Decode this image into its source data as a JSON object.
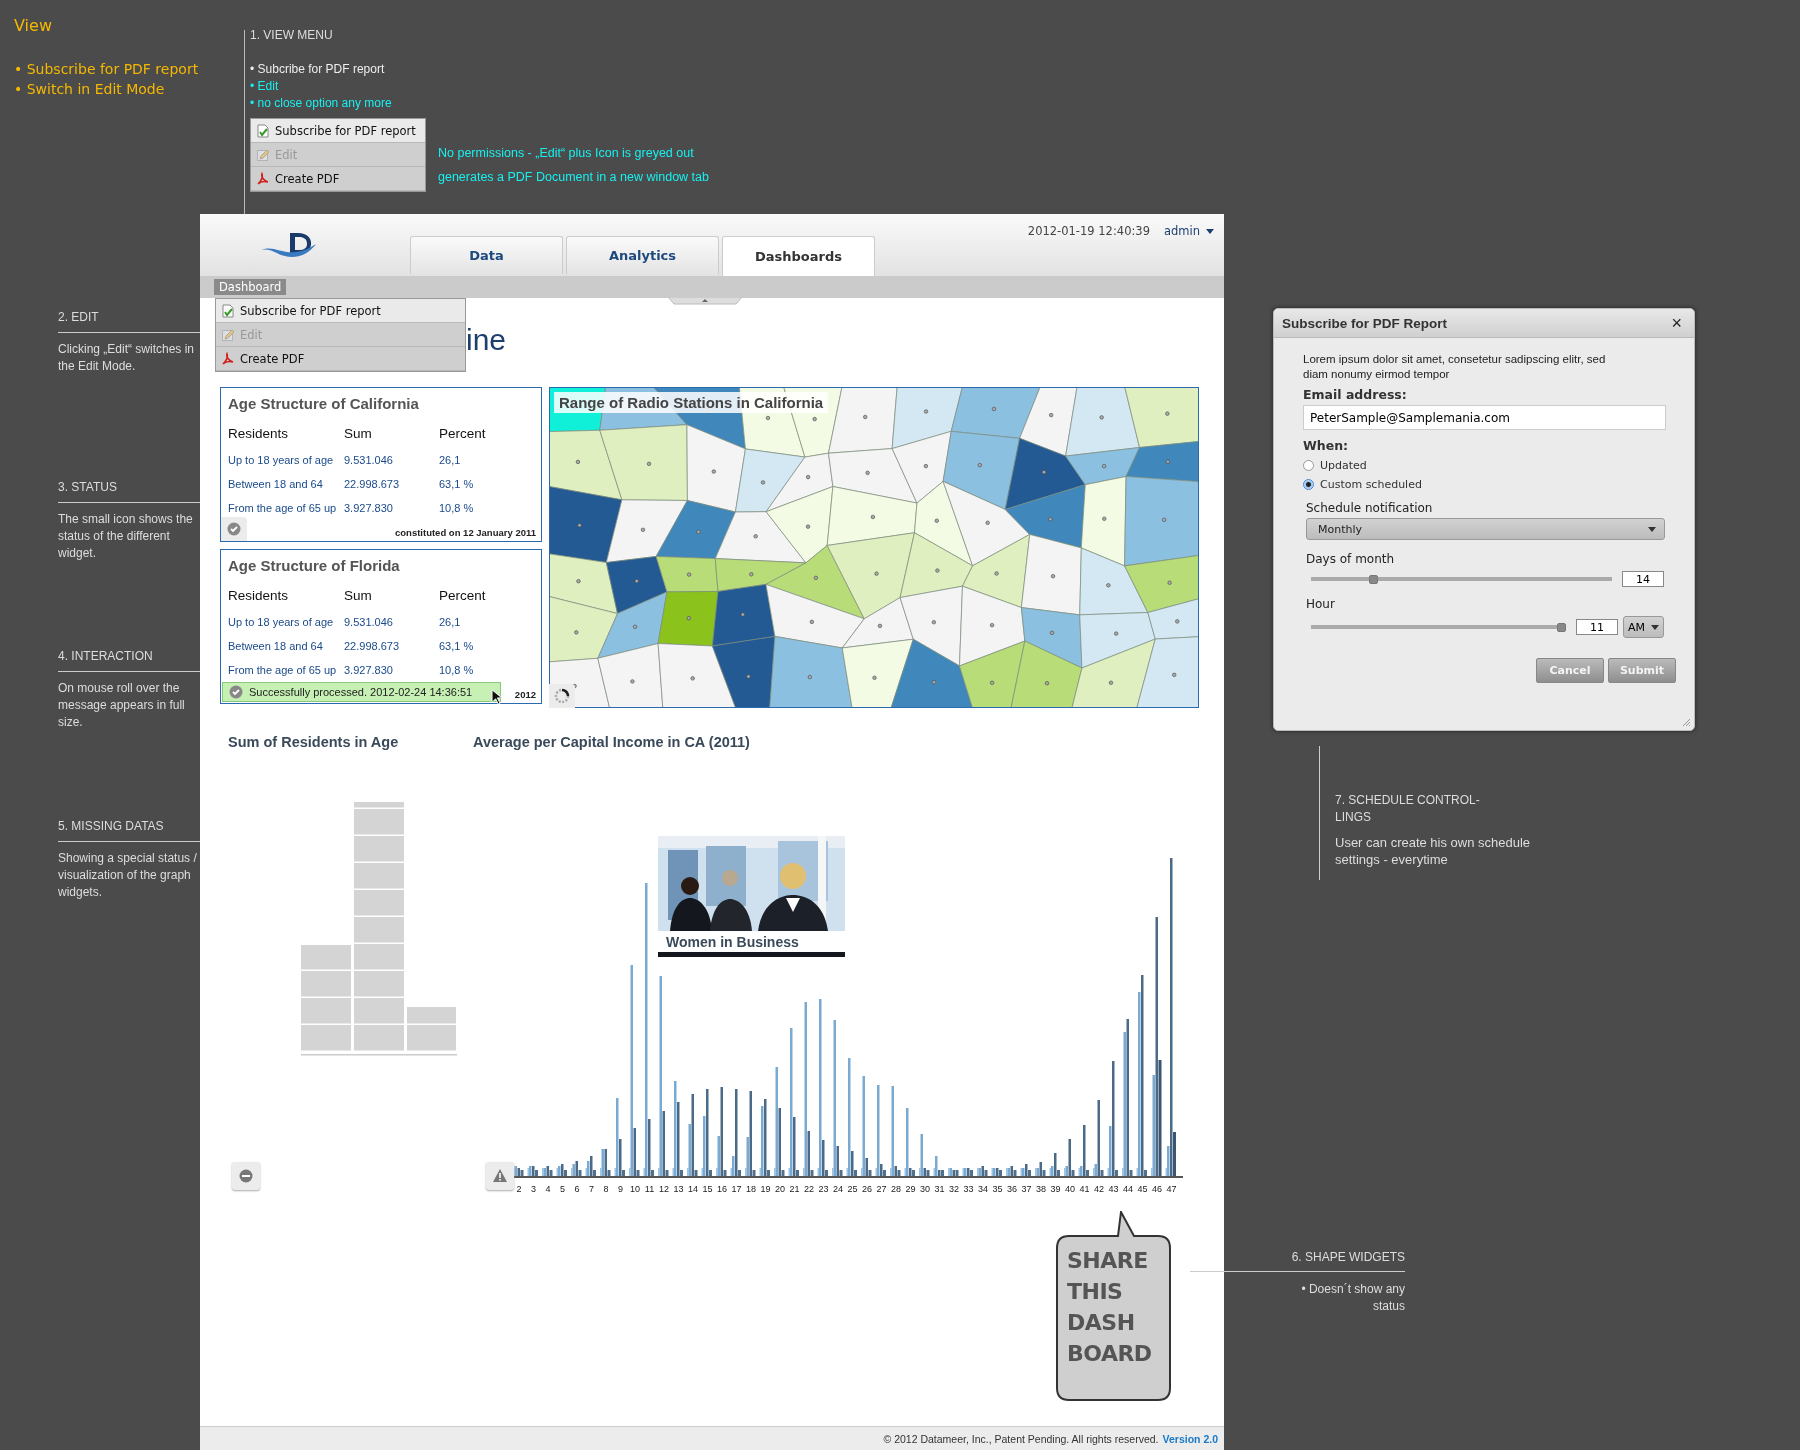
{
  "view_panel": {
    "title": "View",
    "items": [
      "• Subscribe for PDF report",
      "• Switch in Edit Mode"
    ]
  },
  "view_menu_note": {
    "heading": "1. VIEW MENU",
    "bullets": [
      {
        "text": "• Subcribe for PDF report",
        "highlight": false
      },
      {
        "text": "• Edit",
        "highlight": true
      },
      {
        "text": "• no close option any more",
        "highlight": true
      }
    ],
    "menu": [
      {
        "label": "Subscribe for PDF report",
        "kind": "subscribe",
        "disabled": false
      },
      {
        "label": "Edit",
        "kind": "edit",
        "disabled": true
      },
      {
        "label": "Create PDF",
        "kind": "pdf",
        "disabled": false
      }
    ],
    "notes": [
      "No permissions - „Edit“ plus Icon is greyed out",
      "generates a PDF Document in a new window tab"
    ]
  },
  "side_notes": [
    {
      "heading": "2. EDIT",
      "text": "Clicking „Edit“ switches in the Edit Mode."
    },
    {
      "heading": "3. STATUS",
      "text": "The small icon shows the status of the different widget."
    },
    {
      "heading": "4. INTERACTION",
      "text": "On mouse roll over the message appears in full size."
    },
    {
      "heading": "5. MISSING DATAS",
      "text": "Showing a special status / visualization of the graph widgets."
    }
  ],
  "schedule_note": {
    "heading": "7. SCHEDULE CONTROL-LINGS",
    "text": "User can create his own schedule settings - everytime"
  },
  "shape_note": {
    "heading": "6. SHAPE WIDGETS",
    "text": "• Doesn´t show any status"
  },
  "app": {
    "tabs": [
      {
        "label": "Data",
        "selected": false
      },
      {
        "label": "Analytics",
        "selected": false
      },
      {
        "label": "Dashboards",
        "selected": true
      }
    ],
    "datetime": "2012-01-19 12:40:39",
    "user": "admin",
    "breadcrumb": "Dashboard",
    "menu": [
      {
        "label": "Subscribe for PDF report",
        "kind": "subscribe",
        "disabled": false
      },
      {
        "label": "Edit",
        "kind": "edit",
        "disabled": true
      },
      {
        "label": "Create PDF",
        "kind": "pdf",
        "disabled": false
      }
    ],
    "title_fragment": "ine",
    "tables": [
      {
        "title": "Age Structure of California",
        "columns": [
          "Residents",
          "Sum",
          "Percent"
        ],
        "rows": [
          [
            "Up to 18 years of age",
            "9.531.046",
            "26,1"
          ],
          [
            "Between 18 and 64",
            "22.998.673",
            "63,1 %"
          ],
          [
            "From the age of 65 up",
            "3.927.830",
            "10,8 %"
          ]
        ],
        "footnote": "constituted on 12 January 2011",
        "status": {
          "kind": "ok"
        }
      },
      {
        "title": "Age Structure of Florida",
        "columns": [
          "Residents",
          "Sum",
          "Percent"
        ],
        "rows": [
          [
            "Up to 18 years of age",
            "9.531.046",
            "26,1"
          ],
          [
            "Between 18 and 64",
            "22.998.673",
            "63,1 %"
          ],
          [
            "From the age of 65 up",
            "3.927.830",
            "10,8 %"
          ]
        ],
        "footnote": "2012",
        "status": {
          "kind": "ok"
        },
        "message": "Successfully processed. 2012-02-24 14:36:51"
      }
    ],
    "map": {
      "title": "Range of Radio Stations in California",
      "status": {
        "kind": "loading"
      }
    },
    "charts": [
      {
        "title": "Sum of Residents in Age",
        "status": {
          "kind": "missing"
        }
      },
      {
        "title": "Average per Capital Income in CA (2011)",
        "status": {
          "kind": "warning"
        },
        "x_labels": [
          "2",
          "3",
          "4",
          "5",
          "6",
          "7",
          "8",
          "9",
          "10",
          "11",
          "12",
          "13",
          "14",
          "15",
          "16",
          "17",
          "18",
          "19",
          "20",
          "21",
          "22",
          "23",
          "24",
          "25",
          "26",
          "27",
          "28",
          "29",
          "30",
          "31",
          "32",
          "33",
          "34",
          "35",
          "36",
          "37",
          "38",
          "39",
          "40",
          "41",
          "42",
          "43",
          "44",
          "45",
          "46",
          "47"
        ],
        "overlay": {
          "kind": "picture",
          "caption": "Women in Business"
        }
      }
    ],
    "share": {
      "lines": [
        "SHARE",
        "THIS",
        "DASH",
        "BOARD"
      ]
    },
    "footer": {
      "text": "© 2012 Datameer, Inc., Patent Pending. All rights reserved.",
      "version": "Version 2.0"
    }
  },
  "dialog": {
    "title": "Subscribe for PDF Report",
    "close": "×",
    "intro": "Lorem ipsum dolor sit amet, consetetur sadipscing elitr, sed diam nonumy eirmod tempor",
    "email_label": "Email address:",
    "email": "PeterSample@Samplemania.com",
    "when_label": "When:",
    "options": [
      {
        "label": "Updated",
        "selected": false
      },
      {
        "label": "Custom scheduled",
        "selected": true
      }
    ],
    "schedule_label": "Schedule notification",
    "schedule": "Monthly",
    "days_label": "Days of month",
    "days": {
      "level": 0.2,
      "value": "14"
    },
    "hour_label": "Hour",
    "hour": {
      "level": 1.0,
      "value": "11",
      "period": "AM"
    },
    "buttons": [
      "Cancel",
      "Submit"
    ]
  }
}
